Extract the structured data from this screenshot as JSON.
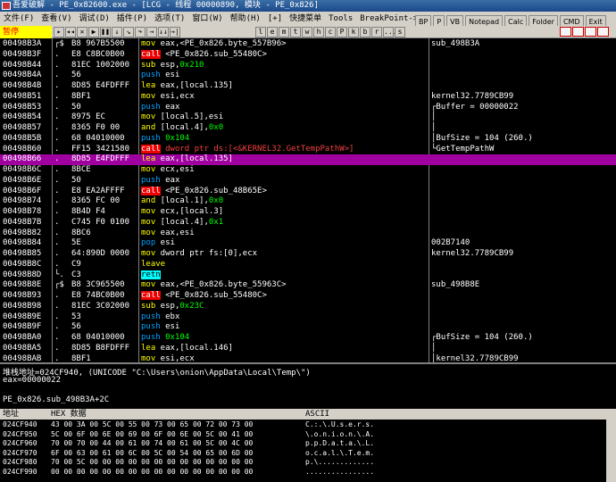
{
  "window": {
    "title": "吾爱破解 - PE_0x82600.exe - [LCG - 线程 00000890, 模块 - PE_0x826]"
  },
  "menu": [
    "文件(F)",
    "查看(V)",
    "调试(D)",
    "插件(P)",
    "选项(T)",
    "窗口(W)",
    "帮助(H)",
    "[+]",
    "快捷菜单",
    "Tools",
    "BreakPoint->"
  ],
  "right_tools": [
    "BP",
    "P",
    "VB",
    "Notepad",
    "Calc",
    "Folder",
    "CMD",
    "Exit"
  ],
  "status_text": "暂停",
  "toolbar_letters": [
    "l",
    "e",
    "m",
    "t",
    "w",
    "h",
    "c",
    "P",
    "k",
    "b",
    "r",
    "...",
    "s"
  ],
  "cpu_rows": [
    {
      "addr": "00498B3A",
      "mk": "┌$",
      "hex": "B8 967B5500",
      "asm": [
        [
          "kw",
          "mov"
        ],
        [
          "w",
          " eax,<PE_0x826.byte_557B96>"
        ]
      ],
      "cmt": "sub_498B3A"
    },
    {
      "addr": "00498B3F",
      "mk": ".",
      "hex": "E8 C8BC0B00",
      "asm": [
        [
          "cl",
          "call"
        ],
        [
          "w",
          " <PE_0x826.sub_55480C>"
        ]
      ],
      "cmt": ""
    },
    {
      "addr": "00498B44",
      "mk": ".",
      "hex": "81EC 1002000",
      "asm": [
        [
          "kw",
          "sub"
        ],
        [
          "w",
          " esp,"
        ],
        [
          "num",
          "0x210"
        ]
      ],
      "cmt": ""
    },
    {
      "addr": "00498B4A",
      "mk": ".",
      "hex": "56",
      "asm": [
        [
          "pp",
          "push"
        ],
        [
          "w",
          " esi"
        ]
      ],
      "cmt": ""
    },
    {
      "addr": "00498B4B",
      "mk": ".",
      "hex": "8D85 E4FDFFF",
      "asm": [
        [
          "kw",
          "lea"
        ],
        [
          "w",
          " eax,[local.135]"
        ]
      ],
      "cmt": ""
    },
    {
      "addr": "00498B51",
      "mk": ".",
      "hex": "8BF1",
      "asm": [
        [
          "kw",
          "mov"
        ],
        [
          "w",
          " esi,ecx"
        ]
      ],
      "cmt": "kernel32.7789CB99"
    },
    {
      "addr": "00498B53",
      "mk": ".",
      "hex": "50",
      "asm": [
        [
          "pp",
          "push"
        ],
        [
          "w",
          " eax"
        ]
      ],
      "cmt": "┌Buffer = 00000022"
    },
    {
      "addr": "00498B54",
      "mk": ".",
      "hex": "8975 EC",
      "asm": [
        [
          "kw",
          "mov"
        ],
        [
          "w",
          " [local.5],esi"
        ]
      ],
      "cmt": "│"
    },
    {
      "addr": "00498B57",
      "mk": ".",
      "hex": "8365 F0 00",
      "asm": [
        [
          "kw",
          "and"
        ],
        [
          "w",
          " [local.4],"
        ],
        [
          "num",
          "0x0"
        ]
      ],
      "cmt": "│"
    },
    {
      "addr": "00498B5B",
      "mk": ".",
      "hex": "68 04010000",
      "asm": [
        [
          "pp",
          "push"
        ],
        [
          "num",
          " 0x104"
        ]
      ],
      "cmt": "│BufSize = 104 (260.)"
    },
    {
      "addr": "00498B60",
      "mk": ".",
      "hex": "FF15 3421580",
      "asm": [
        [
          "cl",
          "call"
        ],
        [
          "red",
          " dword ptr ds:[<&KERNEL32.GetTempPathW>]"
        ]
      ],
      "cmt": "└GetTempPathW",
      "cmtcls": "red"
    },
    {
      "addr": "00498B66",
      "mk": ".",
      "hex": "8D85 E4FDFFF",
      "asm": [
        [
          "kw",
          "lea"
        ],
        [
          "w",
          " eax,[local.135]"
        ]
      ],
      "cmt": "",
      "sel": true
    },
    {
      "addr": "00498B6C",
      "mk": ".",
      "hex": "8BCE",
      "asm": [
        [
          "kw",
          "mov"
        ],
        [
          "w",
          " ecx,esi"
        ]
      ],
      "cmt": ""
    },
    {
      "addr": "00498B6E",
      "mk": ".",
      "hex": "50",
      "asm": [
        [
          "pp",
          "push"
        ],
        [
          "w",
          " eax"
        ]
      ],
      "cmt": ""
    },
    {
      "addr": "00498B6F",
      "mk": ".",
      "hex": "E8 EA2AFFFF",
      "asm": [
        [
          "cl",
          "call"
        ],
        [
          "w",
          " <PE_0x826.sub_48B65E>"
        ]
      ],
      "cmt": ""
    },
    {
      "addr": "00498B74",
      "mk": ".",
      "hex": "8365 FC 00",
      "asm": [
        [
          "kw",
          "and"
        ],
        [
          "w",
          " [local.1],"
        ],
        [
          "num",
          "0x0"
        ]
      ],
      "cmt": ""
    },
    {
      "addr": "00498B78",
      "mk": ".",
      "hex": "8B4D F4",
      "asm": [
        [
          "kw",
          "mov"
        ],
        [
          "w",
          " ecx,[local.3]"
        ]
      ],
      "cmt": ""
    },
    {
      "addr": "00498B7B",
      "mk": ".",
      "hex": "C745 F0 0100",
      "asm": [
        [
          "kw",
          "mov"
        ],
        [
          "w",
          " [local.4],"
        ],
        [
          "num",
          "0x1"
        ]
      ],
      "cmt": ""
    },
    {
      "addr": "00498B82",
      "mk": ".",
      "hex": "8BC6",
      "asm": [
        [
          "kw",
          "mov"
        ],
        [
          "w",
          " eax,esi"
        ]
      ],
      "cmt": ""
    },
    {
      "addr": "00498B84",
      "mk": ".",
      "hex": "5E",
      "asm": [
        [
          "pp",
          "pop"
        ],
        [
          "w",
          " esi"
        ]
      ],
      "cmt": "002B7140"
    },
    {
      "addr": "00498B85",
      "mk": ".",
      "hex": "64:890D 0000",
      "asm": [
        [
          "kw",
          "mov"
        ],
        [
          "w",
          " dword ptr fs:[0],ecx"
        ]
      ],
      "cmt": "kernel32.7789CB99"
    },
    {
      "addr": "00498B8C",
      "mk": ".",
      "hex": "C9",
      "asm": [
        [
          "kw",
          "leave"
        ]
      ],
      "cmt": ""
    },
    {
      "addr": "00498B8D",
      "mk": "└.",
      "hex": "C3",
      "asm": [
        [
          "rt",
          "retn"
        ]
      ],
      "cmt": ""
    },
    {
      "addr": "00498B8E",
      "mk": "┌$",
      "hex": "B8 3C965500",
      "asm": [
        [
          "kw",
          "mov"
        ],
        [
          "w",
          " eax,<PE_0x826.byte_55963C>"
        ]
      ],
      "cmt": "sub_498B8E"
    },
    {
      "addr": "00498B93",
      "mk": ".",
      "hex": "E8 74BC0B00",
      "asm": [
        [
          "cl",
          "call"
        ],
        [
          "w",
          " <PE_0x826.sub_55480C>"
        ]
      ],
      "cmt": ""
    },
    {
      "addr": "00498B98",
      "mk": ".",
      "hex": "81EC 3C02000",
      "asm": [
        [
          "kw",
          "sub"
        ],
        [
          "w",
          " esp,"
        ],
        [
          "num",
          "0x23C"
        ]
      ],
      "cmt": ""
    },
    {
      "addr": "00498B9E",
      "mk": ".",
      "hex": "53",
      "asm": [
        [
          "pp",
          "push"
        ],
        [
          "w",
          " ebx"
        ]
      ],
      "cmt": ""
    },
    {
      "addr": "00498B9F",
      "mk": ".",
      "hex": "56",
      "asm": [
        [
          "pp",
          "push"
        ],
        [
          "w",
          " esi"
        ]
      ],
      "cmt": ""
    },
    {
      "addr": "00498BA0",
      "mk": ".",
      "hex": "68 04010000",
      "asm": [
        [
          "pp",
          "push"
        ],
        [
          "num",
          " 0x104"
        ]
      ],
      "cmt": "┌BufSize = 104 (260.)"
    },
    {
      "addr": "00498BA5",
      "mk": ".",
      "hex": "8D85 B8FDFFF",
      "asm": [
        [
          "kw",
          "lea"
        ],
        [
          "w",
          " eax,[local.146]"
        ]
      ],
      "cmt": "│"
    },
    {
      "addr": "00498BAB",
      "mk": ".",
      "hex": "8BF1",
      "asm": [
        [
          "kw",
          "mov"
        ],
        [
          "w",
          " esi,ecx"
        ]
      ],
      "cmt": "│kernel32.7789CB99"
    }
  ],
  "info_lines": [
    "堆栈地址=024CF940, (UNICODE \"C:\\Users\\onion\\AppData\\Local\\Temp\\\")",
    "eax=00000022",
    "",
    "PE_0x826.sub_498B3A+2C"
  ],
  "dump_header": {
    "addr": "地址",
    "hex": "HEX 数据",
    "ascii": "ASCII"
  },
  "dump_rows": [
    {
      "addr": "024CF940",
      "hex": "43 00 3A 00 5C 00 55 00 73 00 65 00 72 00 73 00",
      "ascii": "C.:.\\.U.s.e.r.s."
    },
    {
      "addr": "024CF950",
      "hex": "5C 00 6F 00 6E 00 69 00 6F 00 6E 00 5C 00 41 00",
      "ascii": "\\.o.n.i.o.n.\\.A."
    },
    {
      "addr": "024CF960",
      "hex": "70 00 70 00 44 00 61 00 74 00 61 00 5C 00 4C 00",
      "ascii": "p.p.D.a.t.a.\\.L."
    },
    {
      "addr": "024CF970",
      "hex": "6F 00 63 00 61 00 6C 00 5C 00 54 00 65 00 6D 00",
      "ascii": "o.c.a.l.\\.T.e.m."
    },
    {
      "addr": "024CF980",
      "hex": "70 00 5C 00 00 00 00 00 00 00 00 00 00 00 00 00",
      "ascii": "p.\\............."
    },
    {
      "addr": "024CF990",
      "hex": "00 00 00 00 00 00 00 00 00 00 00 00 00 00 00 00",
      "ascii": "................"
    }
  ]
}
